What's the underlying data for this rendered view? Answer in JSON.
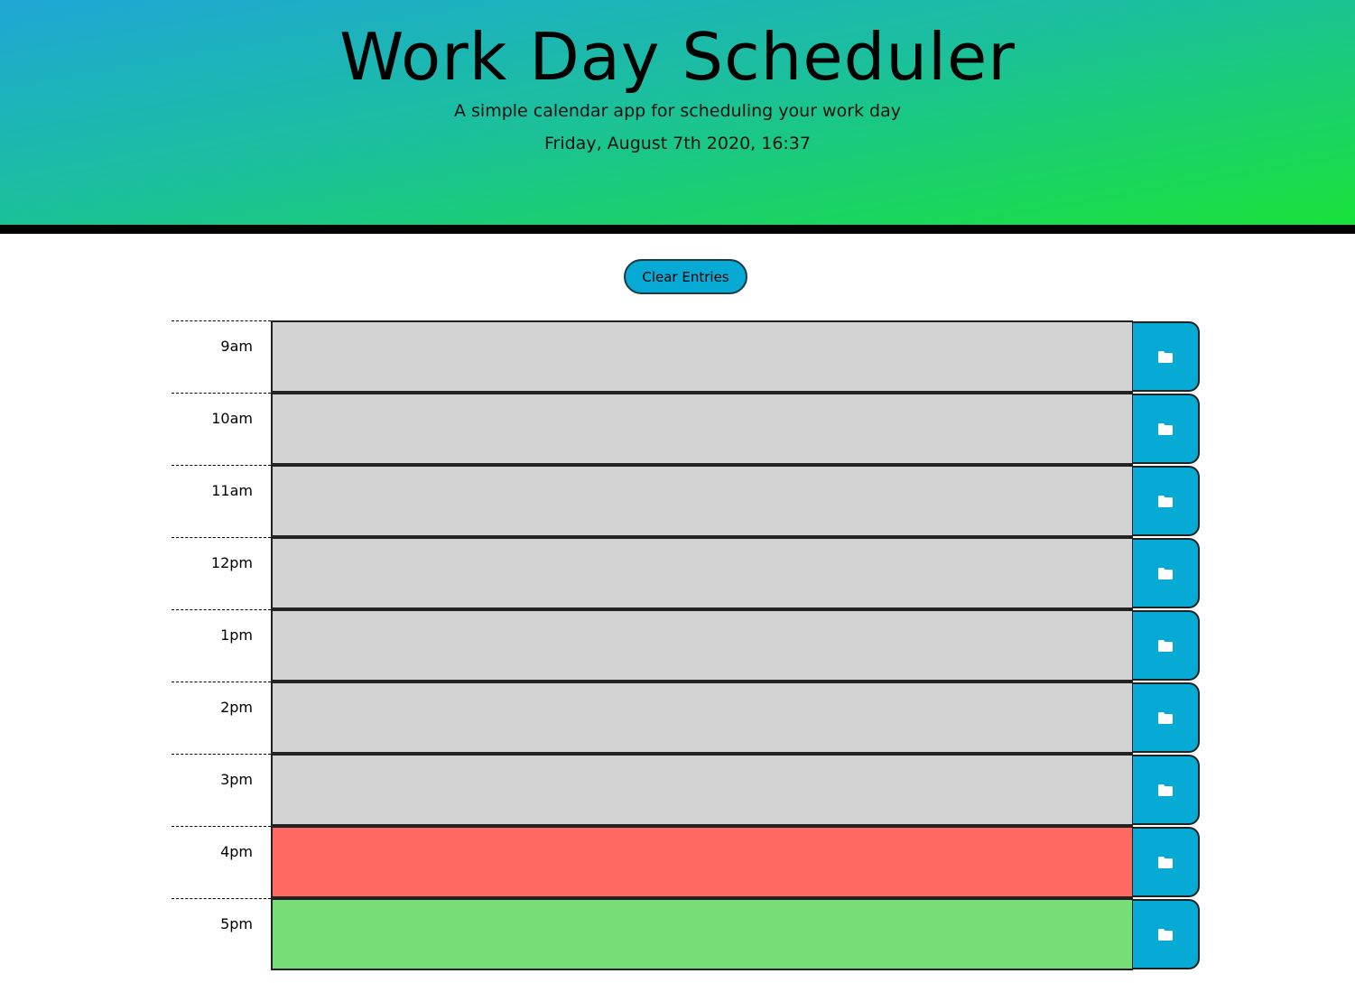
{
  "header": {
    "title": "Work Day Scheduler",
    "subtitle": "A simple calendar app for scheduling your work day",
    "current_day": "Friday, August 7th 2020, 16:37"
  },
  "controls": {
    "clear_label": "Clear Entries"
  },
  "colors": {
    "accent": "#06aad5",
    "past": "#d3d3d3",
    "present": "#ff6961",
    "future": "#77dd77"
  },
  "rows": [
    {
      "hour": "9am",
      "text": "",
      "state": "past",
      "save_icon": "folder-icon"
    },
    {
      "hour": "10am",
      "text": "",
      "state": "past",
      "save_icon": "folder-icon"
    },
    {
      "hour": "11am",
      "text": "",
      "state": "past",
      "save_icon": "folder-icon"
    },
    {
      "hour": "12pm",
      "text": "",
      "state": "past",
      "save_icon": "folder-icon"
    },
    {
      "hour": "1pm",
      "text": "",
      "state": "past",
      "save_icon": "folder-icon"
    },
    {
      "hour": "2pm",
      "text": "",
      "state": "past",
      "save_icon": "folder-icon"
    },
    {
      "hour": "3pm",
      "text": "",
      "state": "past",
      "save_icon": "folder-icon"
    },
    {
      "hour": "4pm",
      "text": "",
      "state": "present",
      "save_icon": "folder-icon"
    },
    {
      "hour": "5pm",
      "text": "",
      "state": "future",
      "save_icon": "folder-icon"
    }
  ]
}
